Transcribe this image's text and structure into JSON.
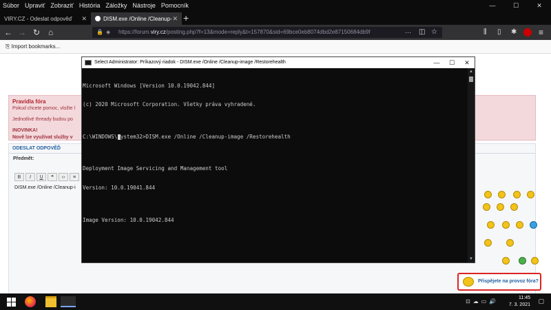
{
  "menu": [
    "Súbor",
    "Upraviť",
    "Zobraziť",
    "História",
    "Záložky",
    "Nástroje",
    "Pomocník"
  ],
  "tabs": [
    {
      "label": "VIRY.CZ - Odeslat odpověď",
      "active": false
    },
    {
      "label": "DISM.exe /Online /Cleanup-im",
      "active": true
    }
  ],
  "url": {
    "prefix": "https://forum.",
    "domain": "viry.cz",
    "rest": "/posting.php?f=13&mode=reply&t=157870&sid=69bce0eb8074dbd2e87150684db9f"
  },
  "bookmarks": {
    "import_label": "Import bookmarks..."
  },
  "page": {
    "rules_title": "Pravidla fóra",
    "rules_line1": "Pokud chcete pomoc, vložte l",
    "rules_line2": "Jednotlivé thready budou po",
    "rules_new": "INOVINKA!",
    "rules_new2": "Nově lze využívat služby v",
    "post_header": "ODESLAT ODPOVĚĎ",
    "subject_label": "Předmět:",
    "editor_text": "DISM.exe /Online /Cleanup-i",
    "donate_label": "Přispějete na provoz fóra?"
  },
  "console": {
    "title": "Select Administrator: Príkazový riadok - DISM.exe  /Online /Cleanup-image /Restorehealth",
    "lines": [
      "Microsoft Windows [Version 10.0.19042.844]",
      "(c) 2020 Microsoft Corporation. Všetky práva vyhradené.",
      "",
      "C:\\WINDOWS\\system32>DISM.exe /Online /Cleanup-image /Restorehealth",
      "",
      "Deployment Image Servicing and Management tool",
      "Version: 10.0.19041.844",
      "",
      "Image Version: 10.0.19042.844"
    ]
  },
  "taskbar": {
    "time": "11:45",
    "date": "7. 3. 2021"
  },
  "colors": {
    "console_bg": "#0c0c0c",
    "console_fg": "#cccccc",
    "firefox_dark": "#0c0c0d",
    "rules_bg": "#f3d9dc"
  }
}
